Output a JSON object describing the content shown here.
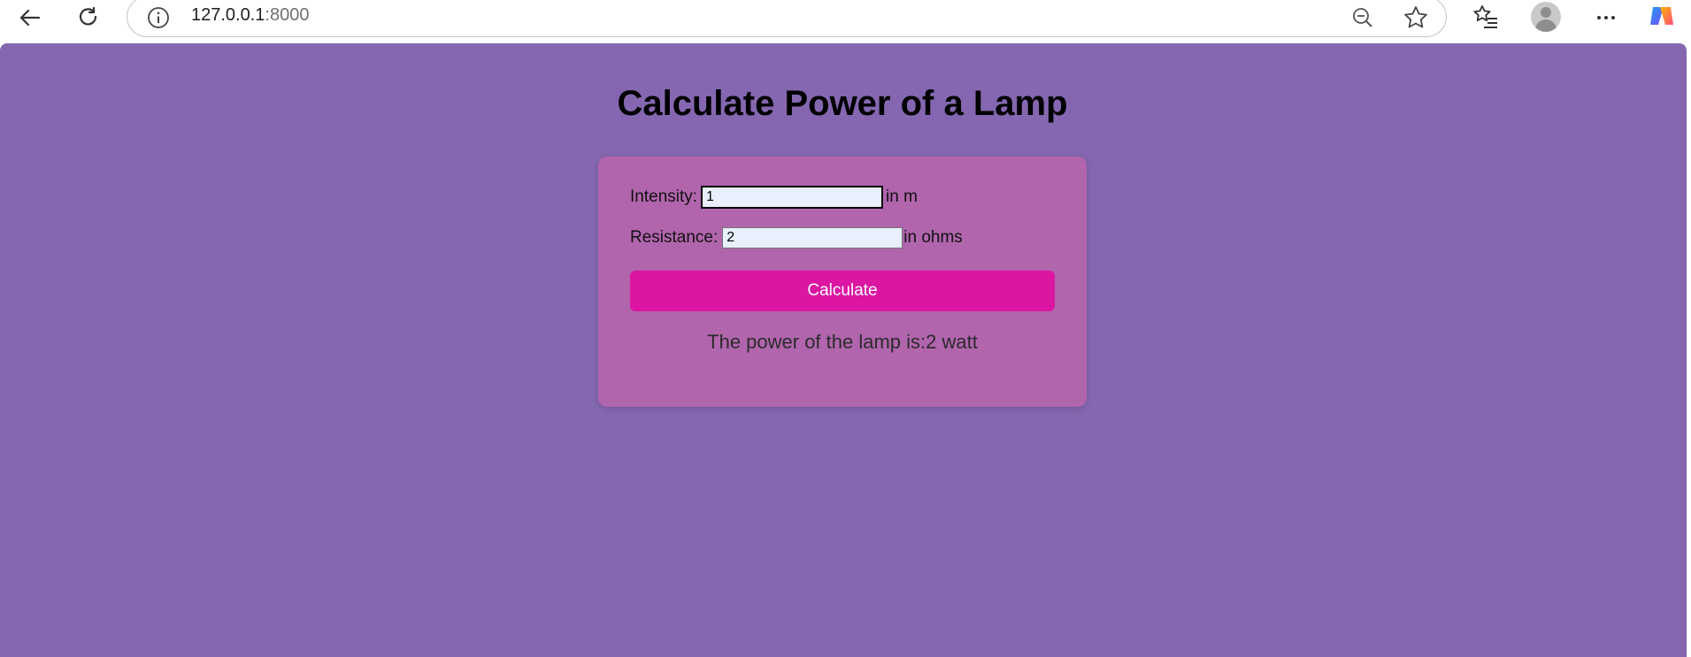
{
  "browser": {
    "url_host": "127.0.0.1",
    "url_port": ":8000",
    "icons": {
      "back": "back-arrow-icon",
      "reload": "reload-icon",
      "info": "info-icon",
      "zoom": "zoom-out-icon",
      "favorite": "star-icon",
      "favorites": "favorites-list-icon",
      "profile": "profile-avatar-icon",
      "menu": "more-menu-icon",
      "copilot": "copilot-icon"
    }
  },
  "page": {
    "title": "Calculate Power of a Lamp",
    "background_color": "#8467b0",
    "card_color": "#b165ad",
    "button_color": "#dc15a3"
  },
  "form": {
    "intensity_label": "Intensity:",
    "intensity_value": "1",
    "intensity_unit": "in m",
    "resistance_label": "Resistance:",
    "resistance_value": "2",
    "resistance_unit": "in ohms",
    "calculate_label": "Calculate"
  },
  "result": {
    "text": "The power of the lamp is:2 watt"
  }
}
